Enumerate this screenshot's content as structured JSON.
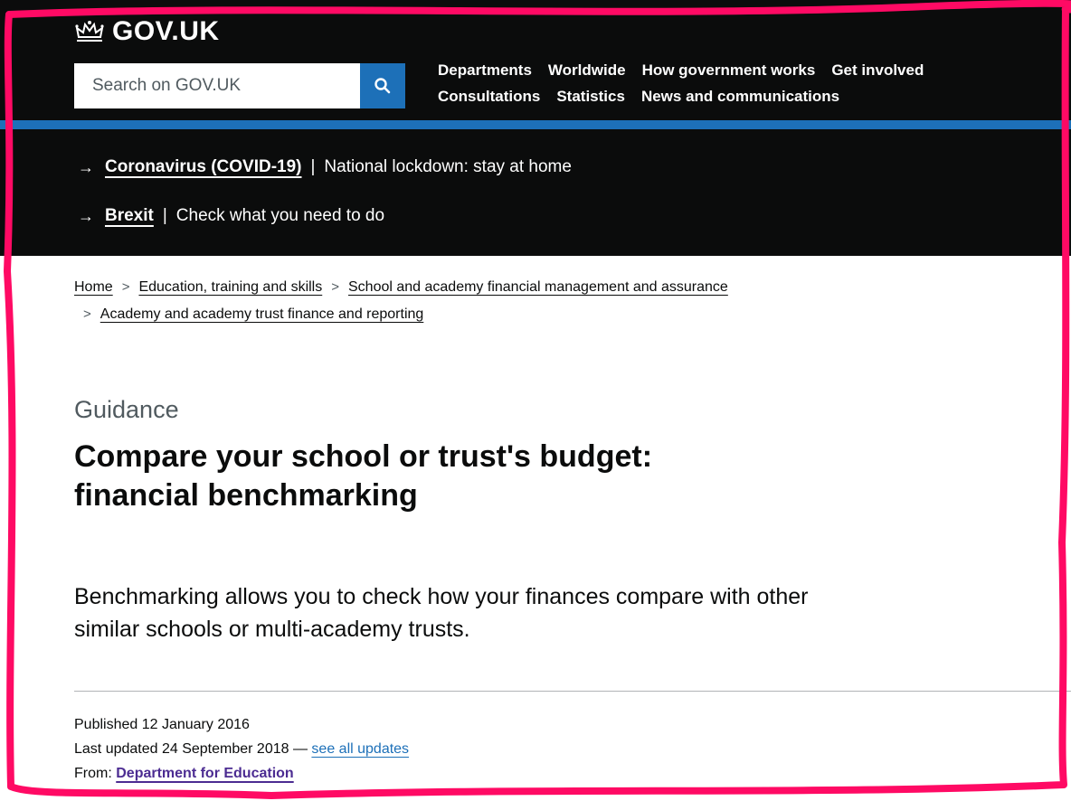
{
  "header": {
    "logo_text": "GOV.UK",
    "search_placeholder": "Search on GOV.UK",
    "nav_row1": [
      "Departments",
      "Worldwide",
      "How government works",
      "Get involved"
    ],
    "nav_row2": [
      "Consultations",
      "Statistics",
      "News and communications"
    ]
  },
  "notices": [
    {
      "link": "Coronavirus (COVID-19)",
      "text": "National lockdown: stay at home"
    },
    {
      "link": "Brexit",
      "text": "Check what you need to do"
    }
  ],
  "breadcrumb": [
    "Home",
    "Education, training and skills",
    "School and academy financial management and assurance",
    "Academy and academy trust finance and reporting"
  ],
  "page": {
    "caption": "Guidance",
    "title": "Compare your school or trust's budget: financial benchmarking",
    "lead": "Benchmarking allows you to check how your finances compare with other similar schools or multi-academy trusts."
  },
  "meta": {
    "published": "Published 12 January 2016",
    "updated": "Last updated 24 September 2018 —",
    "updates_link": "see all updates",
    "from_label": "From:",
    "from_org": "Department for Education"
  },
  "colors": {
    "header_bg": "#0b0c0c",
    "brand_blue": "#1d70b8",
    "frame_pink": "#ff0a64",
    "org_link": "#4c2c92"
  }
}
